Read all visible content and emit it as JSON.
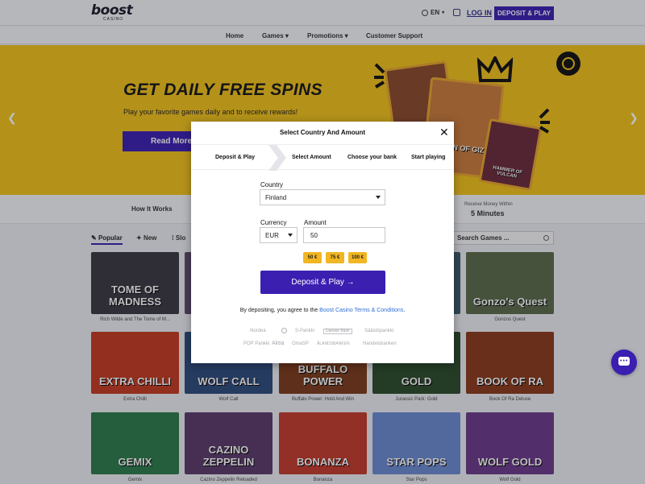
{
  "header": {
    "logo": "boost",
    "logo_sub": "CASINO",
    "language": "EN",
    "login": "LOG IN",
    "deposit_play": "DEPOSIT & PLAY"
  },
  "nav": {
    "items": [
      {
        "label": "Home"
      },
      {
        "label": "Games"
      },
      {
        "label": "Promotions"
      },
      {
        "label": "Customer Support"
      }
    ]
  },
  "hero": {
    "title": "GET DAILY FREE SPINS",
    "subtitle": "Play your favorite games daily and to receive rewards!",
    "read_more": "Read More",
    "card_text_1": "QUEEN OF GIZA",
    "card_text_2": "HAMMER OF VULCAN"
  },
  "info": {
    "how_it_works": "How It Works",
    "receive_small": "Receive Money Within",
    "receive_big": "5 Minutes"
  },
  "filters": {
    "tabs": [
      {
        "label": "Popular"
      },
      {
        "label": "New"
      },
      {
        "label": "Slo"
      }
    ],
    "search_placeholder": "Search Games ..."
  },
  "games": [
    {
      "title": "Rich Wilde and The Tome of M...",
      "art": "TOME OF MADNESS",
      "color": "#3a3640"
    },
    {
      "title": "",
      "art": "",
      "color": "#5a4a6a"
    },
    {
      "title": "",
      "art": "",
      "color": "#6a4a3a"
    },
    {
      "title": "",
      "art": "",
      "color": "#3a5a6a"
    },
    {
      "title": "Gonzos Quest",
      "art": "Gonzo's Quest",
      "color": "#5a6a4a"
    },
    {
      "title": "Extra Chilli",
      "art": "EXTRA CHILLI",
      "color": "#c2391f"
    },
    {
      "title": "Wolf Call",
      "art": "WOLF CALL",
      "color": "#2c4a7a"
    },
    {
      "title": "Buffalo Power: Hold And Win",
      "art": "BUFFALO POWER",
      "color": "#7a3a1a"
    },
    {
      "title": "Jurassic Park: Gold",
      "art": "GOLD",
      "color": "#2a4a2a"
    },
    {
      "title": "Book Of Ra Deluxe",
      "art": "BOOK OF RA",
      "color": "#8a3a1a"
    },
    {
      "title": "Gemix",
      "art": "GEMIX",
      "color": "#2a7a4a"
    },
    {
      "title": "Cazino Zeppelin Reloaded",
      "art": "CAZINO ZEPPELIN",
      "color": "#5a3a6a"
    },
    {
      "title": "Bonanza",
      "art": "BONANZA",
      "color": "#c23a2a"
    },
    {
      "title": "Star Pops",
      "art": "STAR POPS",
      "color": "#6a8ad0"
    },
    {
      "title": "Wolf Gold",
      "art": "WOLF GOLD",
      "color": "#6a3a8a"
    }
  ],
  "modal": {
    "title": "Select Country And Amount",
    "close": "✕",
    "steps": [
      {
        "label": "Deposit & Play"
      },
      {
        "label": "Select Amount"
      },
      {
        "label": "Choose your bank"
      },
      {
        "label": "Start playing"
      }
    ],
    "country_label": "Country",
    "country_value": "Finland",
    "currency_label": "Currency",
    "currency_value": "EUR",
    "amount_label": "Amount",
    "amount_value": "50",
    "chips": [
      "50 €",
      "75 €",
      "100 €"
    ],
    "cta": "Deposit & Play →",
    "terms_prefix": "By depositing, you agree to the ",
    "terms_link": "Boost Casino Terms & Conditions",
    "terms_suffix": ".",
    "banks_row1": [
      "Nordea",
      "",
      "S-Pankki",
      "Danske Bank",
      "Säästöpankki"
    ],
    "banks_row2": [
      "POP Pankki",
      "Aktia",
      "OmaSP",
      "ÅLANDSBANKEN",
      "Handelsbanken"
    ]
  },
  "colors": {
    "brand": "#3a1fb0",
    "hero_bg": "#f2c21a",
    "chip": "#f1b621",
    "link": "#2f6fd6"
  }
}
